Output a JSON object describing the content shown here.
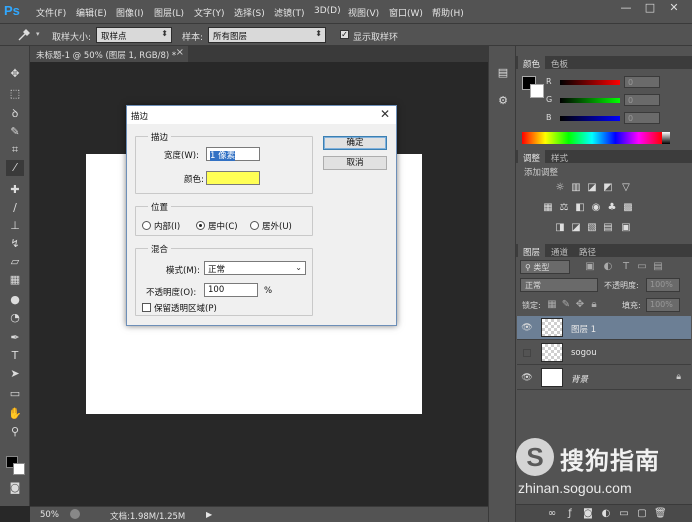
{
  "app": {
    "logo": "Ps"
  },
  "menu": [
    "文件(F)",
    "编辑(E)",
    "图像(I)",
    "图层(L)",
    "文字(Y)",
    "选择(S)",
    "滤镜(T)",
    "3D(D)",
    "视图(V)",
    "窗口(W)",
    "帮助(H)"
  ],
  "window_controls": {
    "minimize": "—",
    "restore": "□",
    "close": "✕"
  },
  "options_bar": {
    "tool_icon": "eyedropper-icon",
    "sample_size_label": "取样大小:",
    "sample_size_value": "取样点",
    "sample_label": "样本:",
    "sample_value": "所有图层",
    "show_ring_label": "显示取样环",
    "show_ring_checked": true
  },
  "document_tab": {
    "title": "未标题-1 @ 50% (图层 1, RGB/8) *",
    "close": "×"
  },
  "status_bar": {
    "zoom": "50%",
    "doc_info": "文档:1.98M/1.25M"
  },
  "dialog": {
    "title": "描边",
    "close": "✕",
    "stroke_group": "描边",
    "width_label": "宽度(W):",
    "width_value": "1 像素",
    "color_label": "颜色:",
    "color_value": "#ffff55",
    "position_group": "位置",
    "position_options": [
      {
        "label": "内部(I)",
        "checked": false
      },
      {
        "label": "居中(C)",
        "checked": true
      },
      {
        "label": "居外(U)",
        "checked": false
      }
    ],
    "blend_group": "混合",
    "mode_label": "模式(M):",
    "mode_value": "正常",
    "opacity_label": "不透明度(O):",
    "opacity_value": "100",
    "opacity_unit": "%",
    "preserve_label": "保留透明区域(P)",
    "preserve_checked": false,
    "ok_label": "确定",
    "cancel_label": "取消"
  },
  "color_panel": {
    "tabs": [
      "颜色",
      "色板"
    ],
    "rows": [
      {
        "label": "R",
        "value": "0"
      },
      {
        "label": "G",
        "value": "0"
      },
      {
        "label": "B",
        "value": "0"
      }
    ]
  },
  "adjustments_panel": {
    "tabs": [
      "调整",
      "样式"
    ],
    "subtitle": "添加调整"
  },
  "layers_panel": {
    "tabs": [
      "图层",
      "通道",
      "路径"
    ],
    "filter_kind": "类型",
    "blend_mode": "正常",
    "opacity_label": "不透明度:",
    "opacity_value": "100%",
    "lock_label": "锁定:",
    "fill_label": "填充:",
    "fill_value": "100%",
    "layers": [
      {
        "name": "图层 1",
        "visible": true,
        "selected": true,
        "thumb": "transparent"
      },
      {
        "name": "sogou",
        "visible": false,
        "selected": false,
        "thumb": "transparent"
      },
      {
        "name": "背景",
        "visible": true,
        "selected": false,
        "thumb": "white",
        "locked": true
      }
    ]
  },
  "watermark": {
    "logo": "S",
    "title": "搜狗指南",
    "url": "zhinan.sogou.com"
  }
}
